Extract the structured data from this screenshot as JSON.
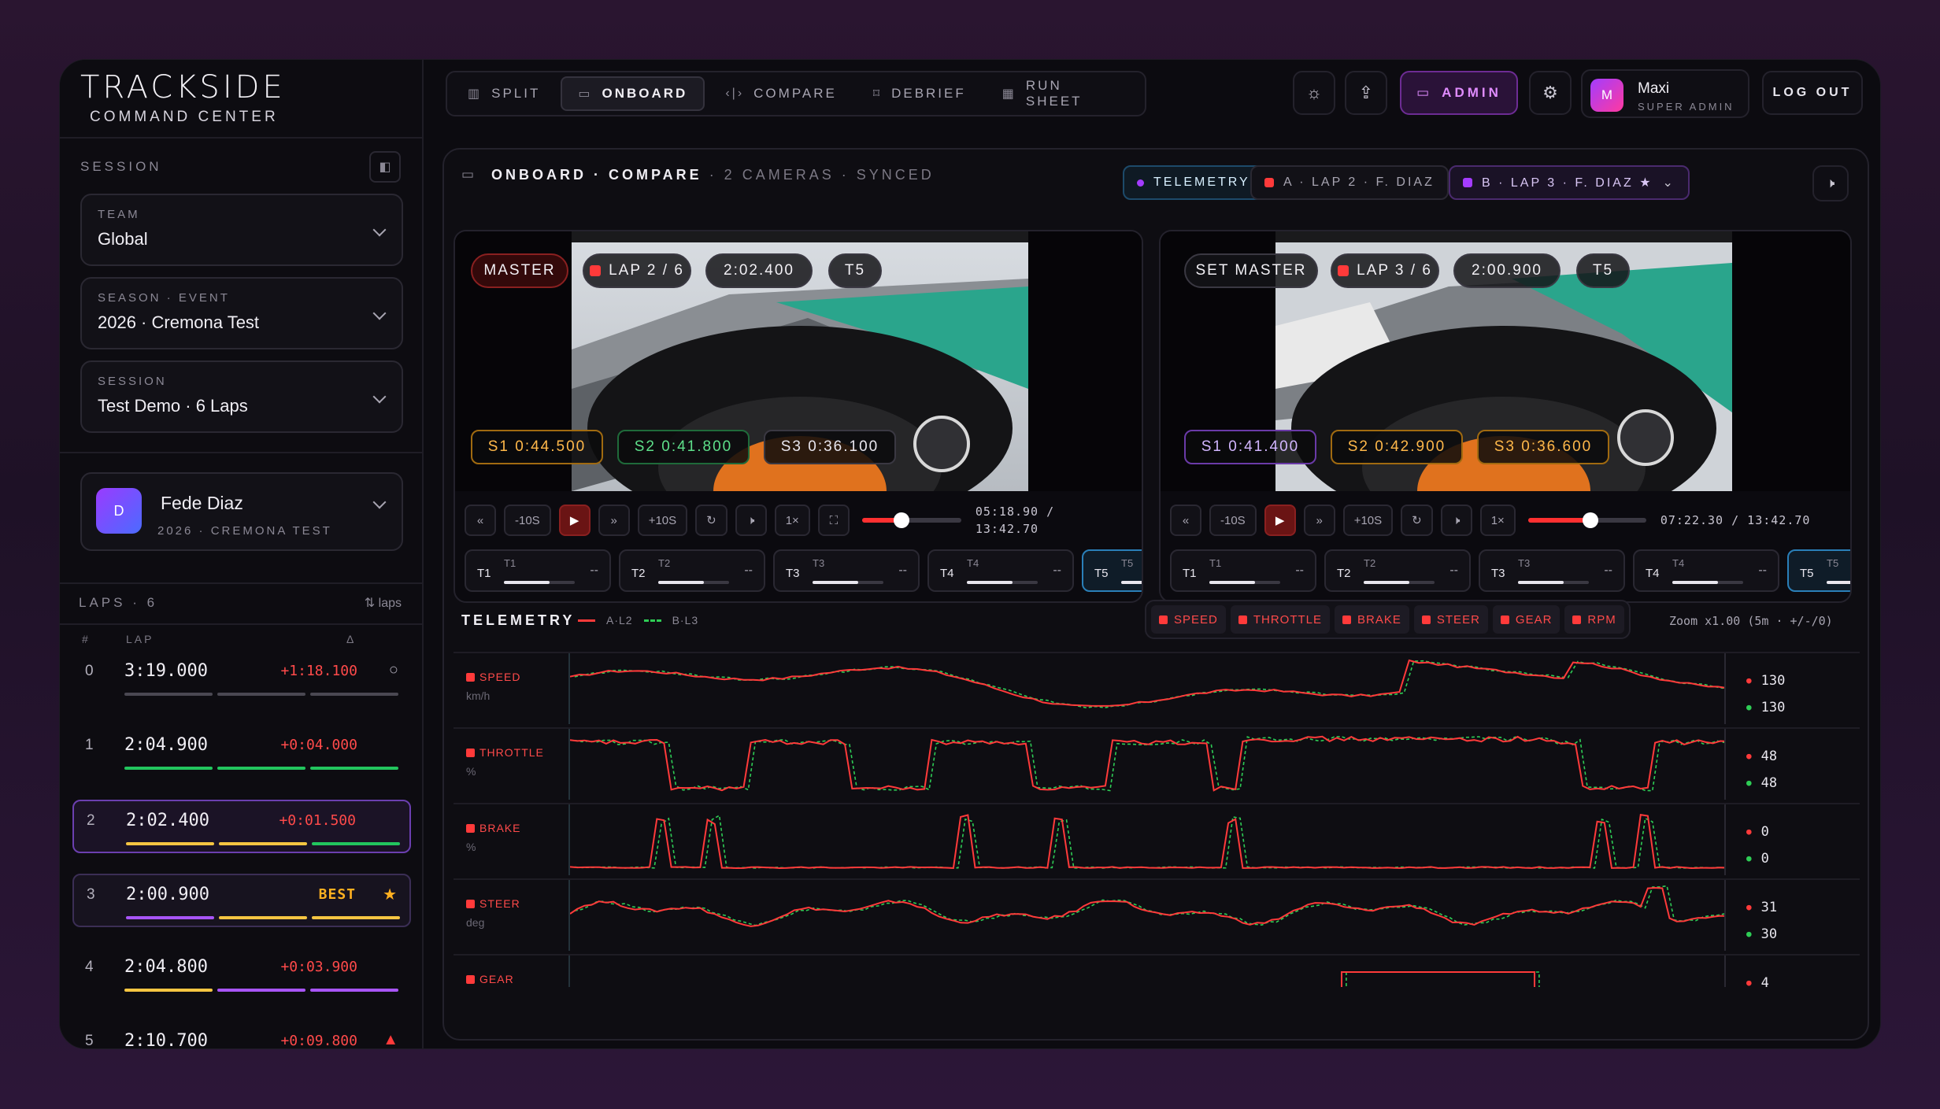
{
  "brand": {
    "name": "TRACKSIDE",
    "subtitle": "COMMAND CENTER"
  },
  "sidebar": {
    "session_label": "SESSION",
    "selects": [
      {
        "label": "TEAM",
        "value": "Global"
      },
      {
        "label": "SEASON · EVENT",
        "value": "2026 · Cremona Test"
      },
      {
        "label": "SESSION",
        "value": "Test Demo · 6 Laps"
      }
    ],
    "driver": {
      "initial": "D",
      "name": "Fede Diaz",
      "sub": "2026 · CREMONA TEST"
    },
    "laps_label": "LAPS · 6",
    "laps_sort": "⇅ laps",
    "columns": {
      "num": "#",
      "lap": "LAP",
      "delta": "Δ"
    },
    "laps": [
      {
        "num": "0",
        "time": "3:19.000",
        "delta": "+1:18.100",
        "icon": "○"
      },
      {
        "num": "1",
        "time": "2:04.900",
        "delta": "+0:04.000",
        "icon": ""
      },
      {
        "num": "2",
        "time": "2:02.400",
        "delta": "+0:01.500",
        "icon": ""
      },
      {
        "num": "3",
        "time": "2:00.900",
        "delta": "BEST",
        "icon": "★"
      },
      {
        "num": "4",
        "time": "2:04.800",
        "delta": "+0:03.900",
        "icon": ""
      },
      {
        "num": "5",
        "time": "2:10.700",
        "delta": "+0:09.800",
        "icon": "▲"
      }
    ]
  },
  "nav": {
    "tabs": [
      {
        "label": "SPLIT",
        "icon": "▥"
      },
      {
        "label": "ONBOARD",
        "icon": "▭"
      },
      {
        "label": "COMPARE",
        "icon": "‹|›"
      },
      {
        "label": "DEBRIEF",
        "icon": "⌑"
      },
      {
        "label": "RUN SHEET",
        "icon": "▦"
      }
    ],
    "admin_label": "ADMIN",
    "user": {
      "initial": "M",
      "name": "Maxi",
      "role": "SUPER ADMIN"
    },
    "logout_label": "LOG OUT"
  },
  "panel": {
    "title": "ONBOARD · COMPARE",
    "subtitle": "· 2 CAMERAS · SYNCED",
    "telemetry_toggle": "TELEMETRY",
    "lap_a": "A · LAP 2 · F. DIAZ",
    "lap_b": "B · LAP 3 · F. DIAZ ★",
    "video_a": {
      "role": "MASTER",
      "lap": "LAP 2 / 6",
      "time": "2:02.400",
      "turn": "T5",
      "sectors": [
        "S1 0:44.500",
        "S2 0:41.800",
        "S3 0:36.100"
      ],
      "skip_back": "-10S",
      "skip_fwd": "+10S",
      "speed": "1×",
      "timestamp_a": "05:18.90 /",
      "timestamp_b": "13:42.70",
      "progress": 0.4
    },
    "video_b": {
      "role": "SET MASTER",
      "lap": "LAP 3 / 6",
      "time": "2:00.900",
      "turn": "T5",
      "sectors": [
        "S1 0:41.400",
        "S2 0:42.900",
        "S3 0:36.600"
      ],
      "skip_back": "-10S",
      "skip_fwd": "+10S",
      "speed": "1×",
      "timestamp_a": "07:22.30 / 13:42.70",
      "progress": 0.53
    },
    "turns": [
      {
        "label": "T1",
        "sub": "T1",
        "delta": "--"
      },
      {
        "label": "T2",
        "sub": "T2",
        "delta": "--"
      },
      {
        "label": "T3",
        "sub": "T3",
        "delta": "--"
      },
      {
        "label": "T4",
        "sub": "T4",
        "delta": "--"
      },
      {
        "label": "T5",
        "sub": "T5",
        "delta": ""
      }
    ]
  },
  "telemetry": {
    "title": "TELEMETRY",
    "legend_a": "A·L2",
    "legend_b": "B·L3",
    "chips": [
      "SPEED",
      "THROTTLE",
      "BRAKE",
      "STEER",
      "GEAR",
      "RPM"
    ],
    "zoom": "Zoom x1.00 (5m · +/-/0)",
    "channels": [
      {
        "name": "SPEED",
        "unit": "km/h",
        "a": "130",
        "b": "130"
      },
      {
        "name": "THROTTLE",
        "unit": "%",
        "a": "48",
        "b": "48"
      },
      {
        "name": "BRAKE",
        "unit": "%",
        "a": "0",
        "b": "0"
      },
      {
        "name": "STEER",
        "unit": "deg",
        "a": "31",
        "b": "30"
      },
      {
        "name": "GEAR",
        "unit": "",
        "a": "4",
        "b": ""
      }
    ]
  },
  "colors": {
    "accent": "#a43cff",
    "lap_a": "#ff3a3a",
    "lap_b": "#2ecc55",
    "best": "#ffb020"
  }
}
